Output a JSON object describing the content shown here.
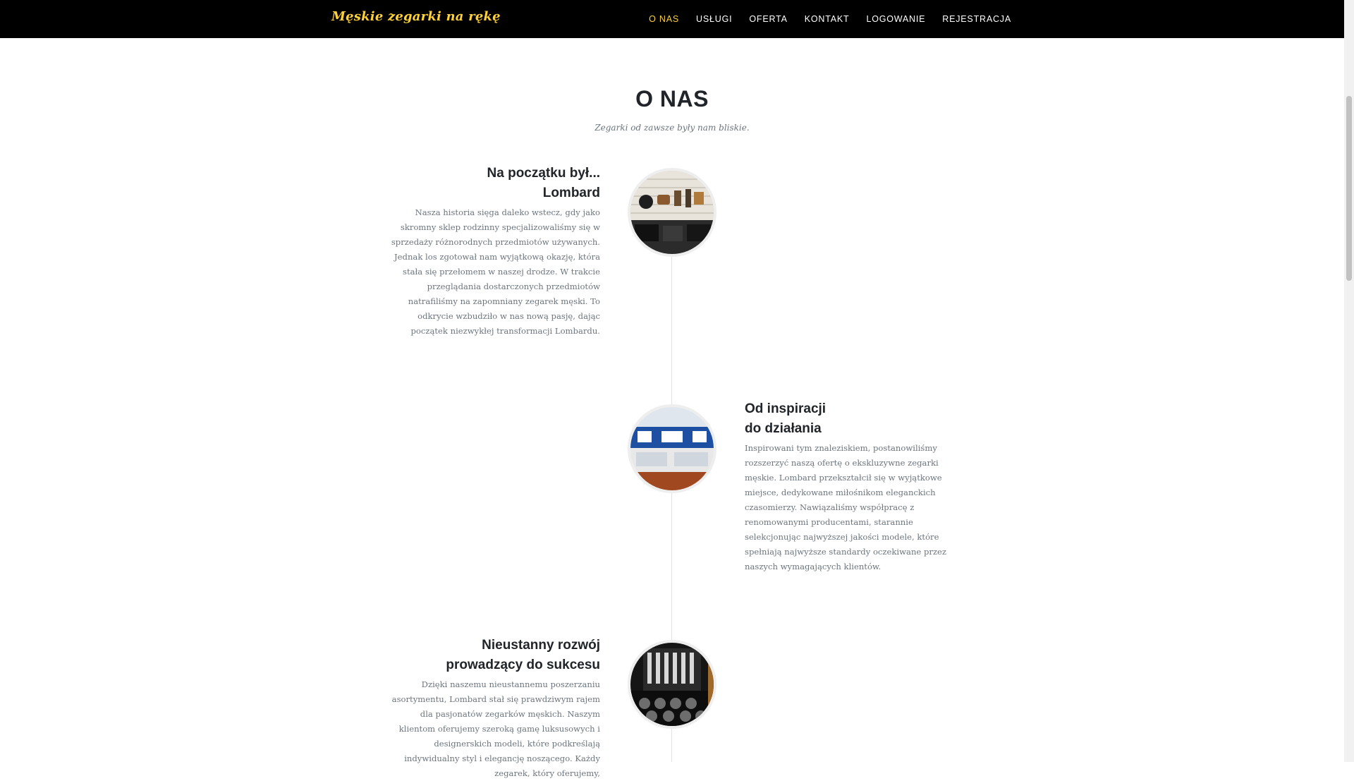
{
  "nav": {
    "brand": "Męskie zegarki na rękę",
    "items": [
      {
        "label": "O NAS",
        "active": true
      },
      {
        "label": "USŁUGI",
        "active": false
      },
      {
        "label": "OFERTA",
        "active": false
      },
      {
        "label": "KONTAKT",
        "active": false
      },
      {
        "label": "LOGOWANIE",
        "active": false
      },
      {
        "label": "REJESTRACJA",
        "active": false
      }
    ]
  },
  "about": {
    "title": "O NAS",
    "subtitle": "Zegarki od zawsze były nam bliskie.",
    "timeline": [
      {
        "heading_line1": "Na początku był...",
        "heading_line2": "Lombard",
        "body": "Nasza historia sięga daleko wstecz, gdy jako skromny sklep rodzinny specjalizowaliśmy się w sprzedaży różnorodnych przedmiotów używanych. Jednak los zgotował nam wyjątkową okazję, która stała się przełomem w naszej drodze. W trakcie przeglądania dostarczonych przedmiotów natrafiliśmy na zapomniany zegarek męski. To odkrycie wzbudziło w nas nową pasję, dając początek niezwykłej transformacji Lombardu."
      },
      {
        "heading_line1": "Od inspiracji",
        "heading_line2": "do działania",
        "body": "Inspirowani tym znaleziskiem, postanowiliśmy rozszerzyć naszą ofertę o ekskluzywne zegarki męskie. Lombard przekształcił się w wyjątkowe miejsce, dedykowane miłośnikom eleganckich czasomierzy. Nawiązaliśmy współpracę z renomowanymi producentami, starannie selekcjonując najwyższej jakości modele, które spełniają najwyższe standardy oczekiwane przez naszych wymagających klientów."
      },
      {
        "heading_line1": "Nieustanny rozwój",
        "heading_line2": "prowadzący do sukcesu",
        "body": "Dzięki naszemu nieustannemu poszerzaniu asortymentu, Lombard stał się prawdziwym rajem dla pasjonatów zegarków męskich. Naszym klientom oferujemy szeroką gamę luksusowych i designerskich modeli, które podkreślają indywidualny styl i elegancję noszącego. Każdy zegarek, który oferujemy,"
      }
    ]
  },
  "colors": {
    "accent": "#fed136",
    "navbar_bg": "#000000",
    "heading": "#212529",
    "muted": "#6c757d"
  }
}
